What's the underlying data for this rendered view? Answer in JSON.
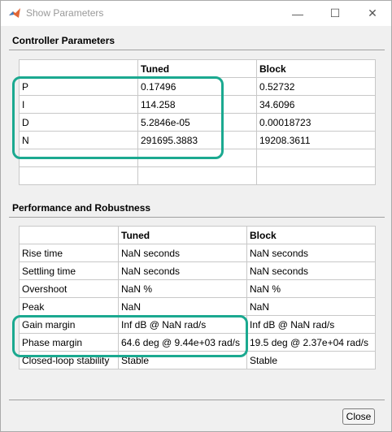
{
  "window": {
    "title": "Show Parameters",
    "icon": "matlab-icon",
    "controls": {
      "minimize": "—",
      "maximize": "☐",
      "close": "✕"
    }
  },
  "controller_parameters": {
    "title": "Controller Parameters",
    "columns": [
      "",
      "Tuned",
      "Block"
    ],
    "rows": [
      [
        "P",
        "0.17496",
        "0.52732"
      ],
      [
        "I",
        "114.258",
        "34.6096"
      ],
      [
        "D",
        "5.2846e-05",
        "0.00018723"
      ],
      [
        "N",
        "291695.3883",
        "19208.3611"
      ],
      [
        "",
        "",
        ""
      ],
      [
        "",
        "",
        ""
      ]
    ]
  },
  "performance": {
    "title": "Performance and Robustness",
    "columns": [
      "",
      "Tuned",
      "Block"
    ],
    "rows": [
      [
        "Rise time",
        "NaN seconds",
        "NaN seconds"
      ],
      [
        "Settling time",
        "NaN seconds",
        "NaN seconds"
      ],
      [
        "Overshoot",
        "NaN %",
        "NaN %"
      ],
      [
        "Peak",
        "NaN",
        "NaN"
      ],
      [
        "Gain margin",
        "Inf dB @ NaN rad/s",
        "Inf dB @ NaN rad/s"
      ],
      [
        "Phase margin",
        "64.6 deg @ 9.44e+03 rad/s",
        "19.5 deg @ 2.37e+04 rad/s"
      ],
      [
        "Closed-loop stability",
        "Stable",
        "Stable"
      ]
    ]
  },
  "footer": {
    "close_label": "Close"
  },
  "colors": {
    "highlight": "#1ba990"
  }
}
